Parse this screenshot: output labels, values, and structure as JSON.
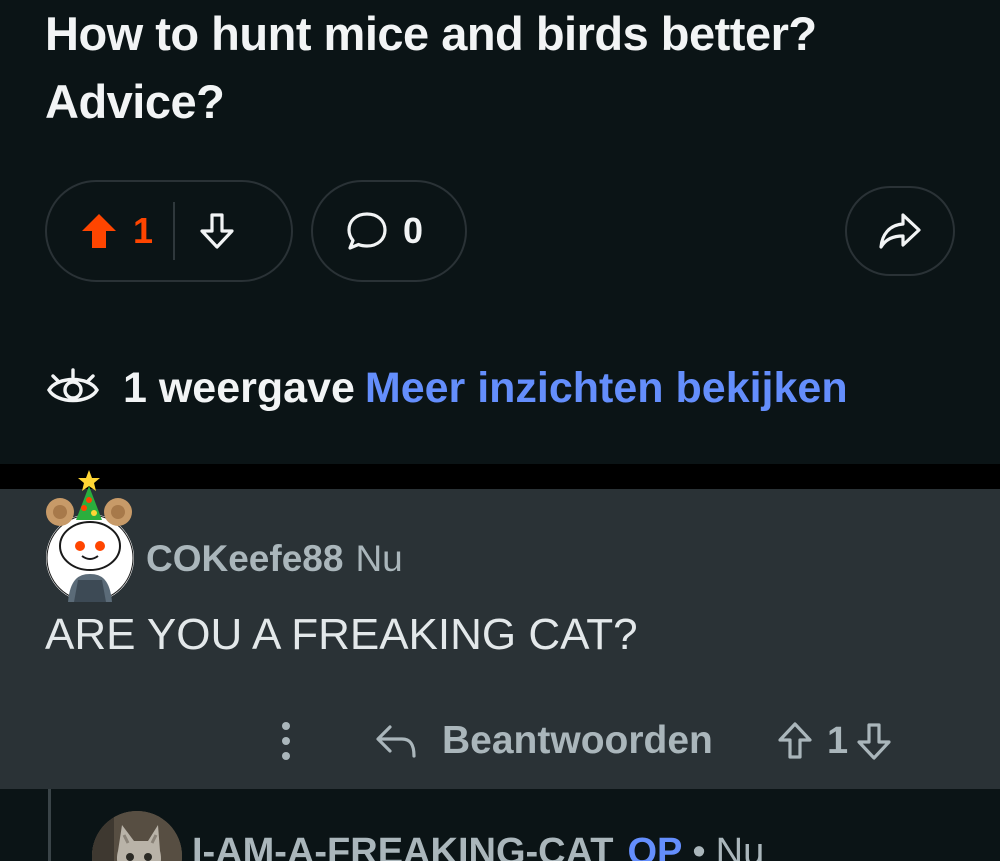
{
  "post": {
    "title": "How to hunt mice and birds better? Advice?",
    "score": "1",
    "comment_count": "0",
    "views": "1 weergave",
    "insights_link": "Meer inzichten bekijken",
    "accent_color": "#ff4500",
    "link_color": "#648efc",
    "icons": {
      "upvote": "upvote-filled-icon",
      "downvote": "downvote-icon",
      "comment": "comment-bubble-icon",
      "share": "share-arrow-icon",
      "views": "eye-icon"
    }
  },
  "comment": {
    "author": "COKeefe88",
    "time": "Nu",
    "body": "ARE YOU A FREAKING CAT?",
    "more_icon": "more-vertical-icon",
    "reply_label": "Beantwoorden",
    "score": "1",
    "icons": {
      "reply": "reply-arrow-icon",
      "upvote": "upvote-icon",
      "downvote": "downvote-icon",
      "avatar": "snoo-avatar-christmas-tree"
    }
  },
  "reply": {
    "author": "I-AM-A-FREAKING-CAT",
    "op_badge": "OP",
    "separator": "•",
    "time": "Nu",
    "avatar_icon": "cat-photo-avatar"
  }
}
